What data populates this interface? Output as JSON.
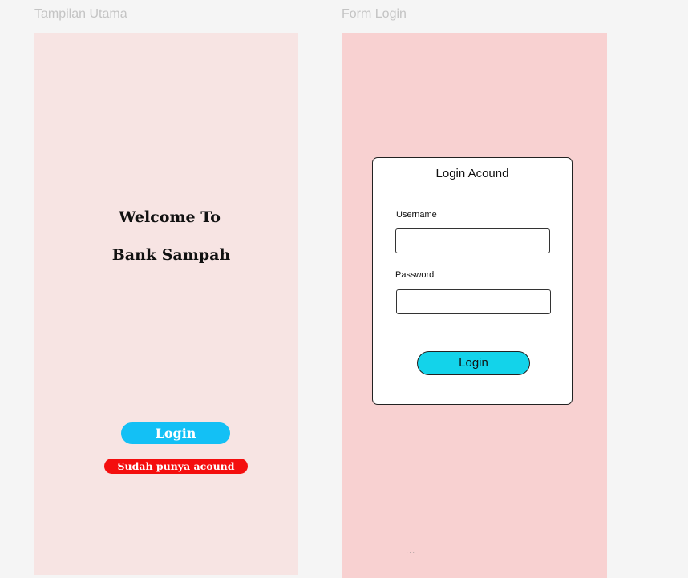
{
  "frames": {
    "main_title": "Tampilan Utama",
    "login_title": "Form Login"
  },
  "main_screen": {
    "welcome_line1": "Welcome To",
    "welcome_line2": "Bank Sampah",
    "login_button": "Login",
    "account_button": "Sudah punya acound"
  },
  "login_screen": {
    "card_title": "Login Acound",
    "username_label": "Username",
    "username_value": "",
    "password_label": "Password",
    "password_value": "",
    "login_button": "Login",
    "more_indicator": "..."
  },
  "colors": {
    "frame_main_bg": "#f7e4e3",
    "frame_login_bg": "#f8d1d1",
    "login_button_main": "#13c0f5",
    "account_button": "#f40e0e",
    "login_button_form": "#13d3ea"
  }
}
